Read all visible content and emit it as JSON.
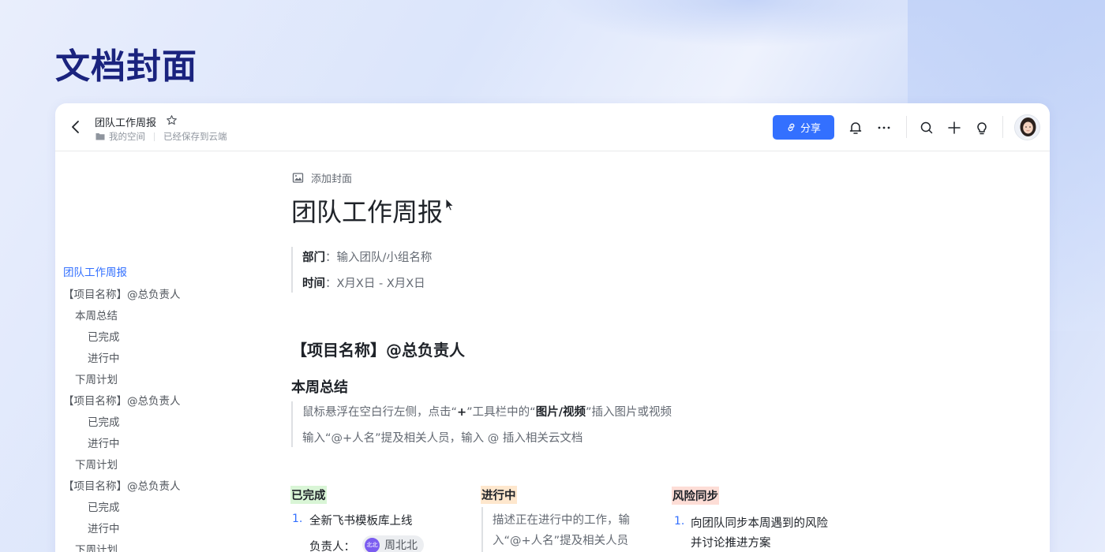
{
  "page_heading": "文档封面",
  "topbar": {
    "doc_title": "团队工作周报",
    "breadcrumb_space": "我的空间",
    "save_status": "已经保存到云端",
    "share_label": "分享",
    "accent_color": "#3370ff"
  },
  "outline": {
    "items": [
      {
        "label": "团队工作周报"
      },
      {
        "label": "【项目名称】@总负责人"
      },
      {
        "label": "本周总结"
      },
      {
        "label": "已完成"
      },
      {
        "label": "进行中"
      },
      {
        "label": "下周计划"
      },
      {
        "label": "【项目名称】@总负责人"
      },
      {
        "label": "已完成"
      },
      {
        "label": "进行中"
      },
      {
        "label": "下周计划"
      },
      {
        "label": "【项目名称】@总负责人"
      },
      {
        "label": "已完成"
      },
      {
        "label": "进行中"
      },
      {
        "label": "下周计划"
      }
    ]
  },
  "doc": {
    "add_cover": "添加封面",
    "title": "团队工作周报",
    "meta": {
      "dept_label": "部门",
      "dept_value": "：输入团队/小组名称",
      "time_label": "时间",
      "time_value": "：X月X日 - X月X日"
    },
    "project_heading": "【项目名称】@总负责人",
    "summary_heading": "本周总结",
    "tips": {
      "line1_a": "鼠标悬浮在空白行左侧，点击“",
      "line1_plus": "+",
      "line1_b": "”工具栏中的“",
      "line1_media": "图片/视频",
      "line1_c": "”插入图片或视频",
      "line2": "输入“@+人名”提及相关人员，输入 @ 插入相关云文档"
    },
    "columns": {
      "done": {
        "tag": "已完成",
        "tag_color": "#d9f5d6",
        "item_num": "1.",
        "item_text": "全新飞书模板库上线",
        "owner_label": "负责人：",
        "owner_avatar_text": "北北",
        "owner_name": "周北北"
      },
      "doing": {
        "tag": "进行中",
        "tag_color": "#fee7cd",
        "line1": "描述正在进行中的工作，输",
        "line2": "入“@+人名”提及相关人员"
      },
      "risk": {
        "tag": "风险同步",
        "tag_color": "#fdddd6",
        "item_num": "1.",
        "line1": "向团队同步本周遇到的风险",
        "line2": "并讨论推进方案"
      }
    }
  }
}
